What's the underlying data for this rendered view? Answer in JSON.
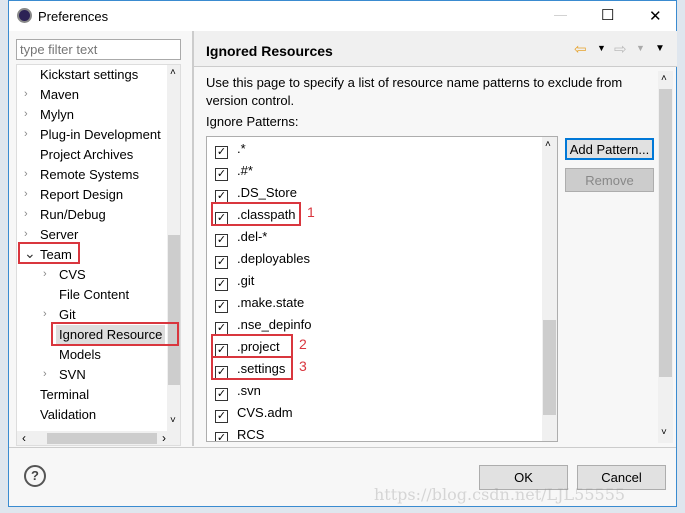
{
  "window": {
    "title": "Preferences",
    "minimize": "—",
    "maximize": "☐",
    "close": "✕"
  },
  "filter": {
    "placeholder": "type filter text"
  },
  "tree": {
    "items": [
      {
        "label": "Kickstart settings",
        "expandable": false,
        "indent": 0
      },
      {
        "label": "Maven",
        "expandable": true,
        "indent": 0
      },
      {
        "label": "Mylyn",
        "expandable": true,
        "indent": 0
      },
      {
        "label": "Plug-in Development",
        "expandable": true,
        "indent": 0
      },
      {
        "label": "Project Archives",
        "expandable": false,
        "indent": 0
      },
      {
        "label": "Remote Systems",
        "expandable": true,
        "indent": 0
      },
      {
        "label": "Report Design",
        "expandable": true,
        "indent": 0
      },
      {
        "label": "Run/Debug",
        "expandable": true,
        "indent": 0
      },
      {
        "label": "Server",
        "expandable": true,
        "indent": 0
      },
      {
        "label": "Team",
        "expandable": true,
        "expanded": true,
        "indent": 0
      },
      {
        "label": "CVS",
        "expandable": true,
        "indent": 1
      },
      {
        "label": "File Content",
        "expandable": false,
        "indent": 1
      },
      {
        "label": "Git",
        "expandable": true,
        "indent": 1
      },
      {
        "label": "Ignored Resource",
        "expandable": false,
        "indent": 1,
        "selected": true
      },
      {
        "label": "Models",
        "expandable": false,
        "indent": 1
      },
      {
        "label": "SVN",
        "expandable": true,
        "indent": 1
      },
      {
        "label": "Terminal",
        "expandable": false,
        "indent": 0
      },
      {
        "label": "Validation",
        "expandable": false,
        "indent": 0
      }
    ]
  },
  "page": {
    "title": "Ignored Resources",
    "description": "Use this page to specify a list of resource name patterns to exclude from version control.",
    "patterns_label": "Ignore Patterns:",
    "patterns": [
      {
        "label": ".*",
        "checked": true
      },
      {
        "label": ".#*",
        "checked": true
      },
      {
        "label": ".DS_Store",
        "checked": true
      },
      {
        "label": ".classpath",
        "checked": true,
        "annotation": "1"
      },
      {
        "label": ".del-*",
        "checked": true
      },
      {
        "label": ".deployables",
        "checked": true
      },
      {
        "label": ".git",
        "checked": true
      },
      {
        "label": ".make.state",
        "checked": true
      },
      {
        "label": ".nse_depinfo",
        "checked": true
      },
      {
        "label": ".project",
        "checked": true,
        "annotation": "2"
      },
      {
        "label": ".settings",
        "checked": true,
        "annotation": "3"
      },
      {
        "label": ".svn",
        "checked": true
      },
      {
        "label": "CVS.adm",
        "checked": true
      },
      {
        "label": "RCS",
        "checked": true
      }
    ],
    "add_button": "Add Pattern...",
    "remove_button": "Remove"
  },
  "footer": {
    "help": "?",
    "ok": "OK",
    "cancel": "Cancel"
  },
  "watermark": "https://blog.csdn.net/LJL55555",
  "colors": {
    "annotation": "#d9363e",
    "accent": "#0078d7"
  }
}
